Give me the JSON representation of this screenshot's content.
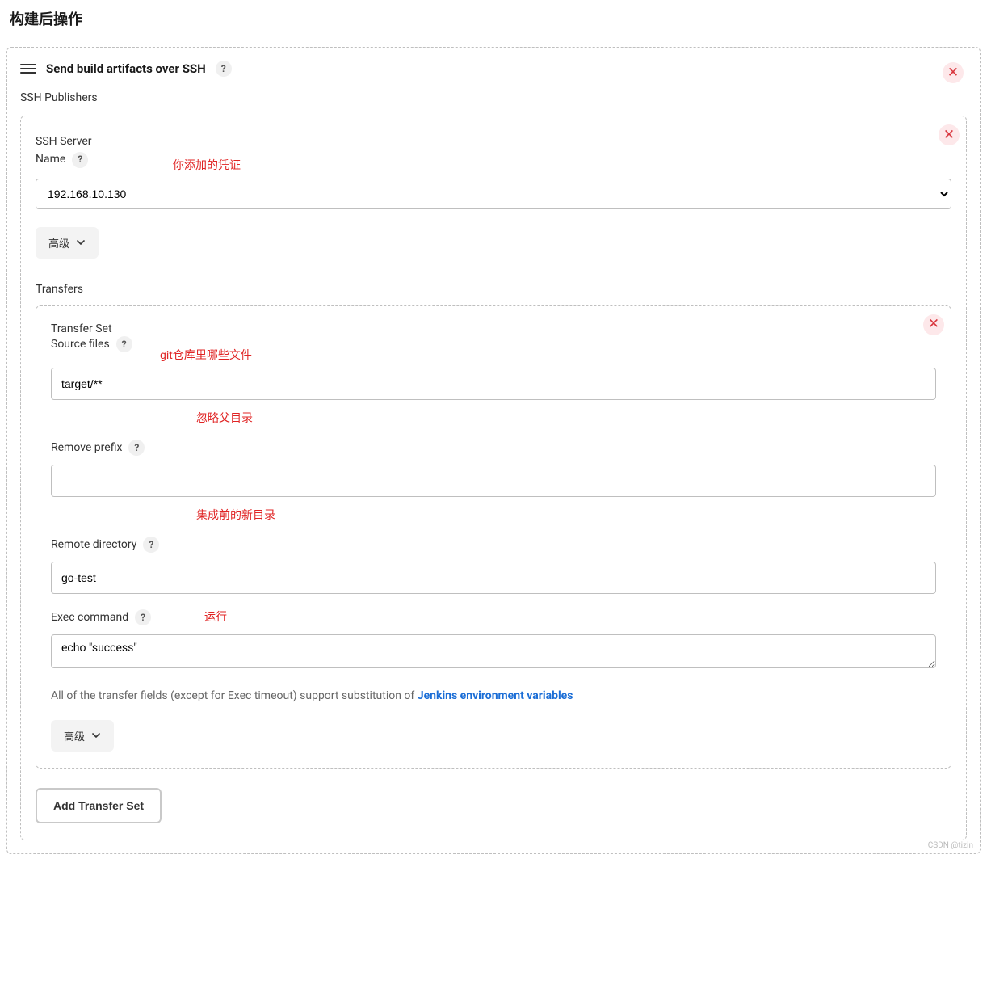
{
  "page": {
    "title": "构建后操作"
  },
  "main": {
    "title": "Send build artifacts over SSH",
    "publishers_label": "SSH Publishers",
    "server": {
      "group_label": "SSH Server",
      "name_label": "Name",
      "note": "你添加的凭证",
      "selected": "192.168.10.130",
      "advanced_label": "高级"
    },
    "transfers": {
      "label": "Transfers",
      "set_label": "Transfer Set",
      "source_files": {
        "label": "Source files",
        "note": "git仓库里哪些文件",
        "value": "target/**"
      },
      "remove_prefix": {
        "label": "Remove prefix",
        "note": "忽略父目录",
        "value": ""
      },
      "remote_directory": {
        "label": "Remote directory",
        "note": "集成前的新目录",
        "value": "go-test"
      },
      "exec_command": {
        "label": "Exec command",
        "note": "运行",
        "value": "echo \"success\""
      },
      "info_prefix": "All of the transfer fields (except for Exec timeout) support substitution of ",
      "info_link": "Jenkins environment variables",
      "advanced_label": "高级",
      "add_button": "Add Transfer Set"
    }
  },
  "watermark": "CSDN @tizin"
}
